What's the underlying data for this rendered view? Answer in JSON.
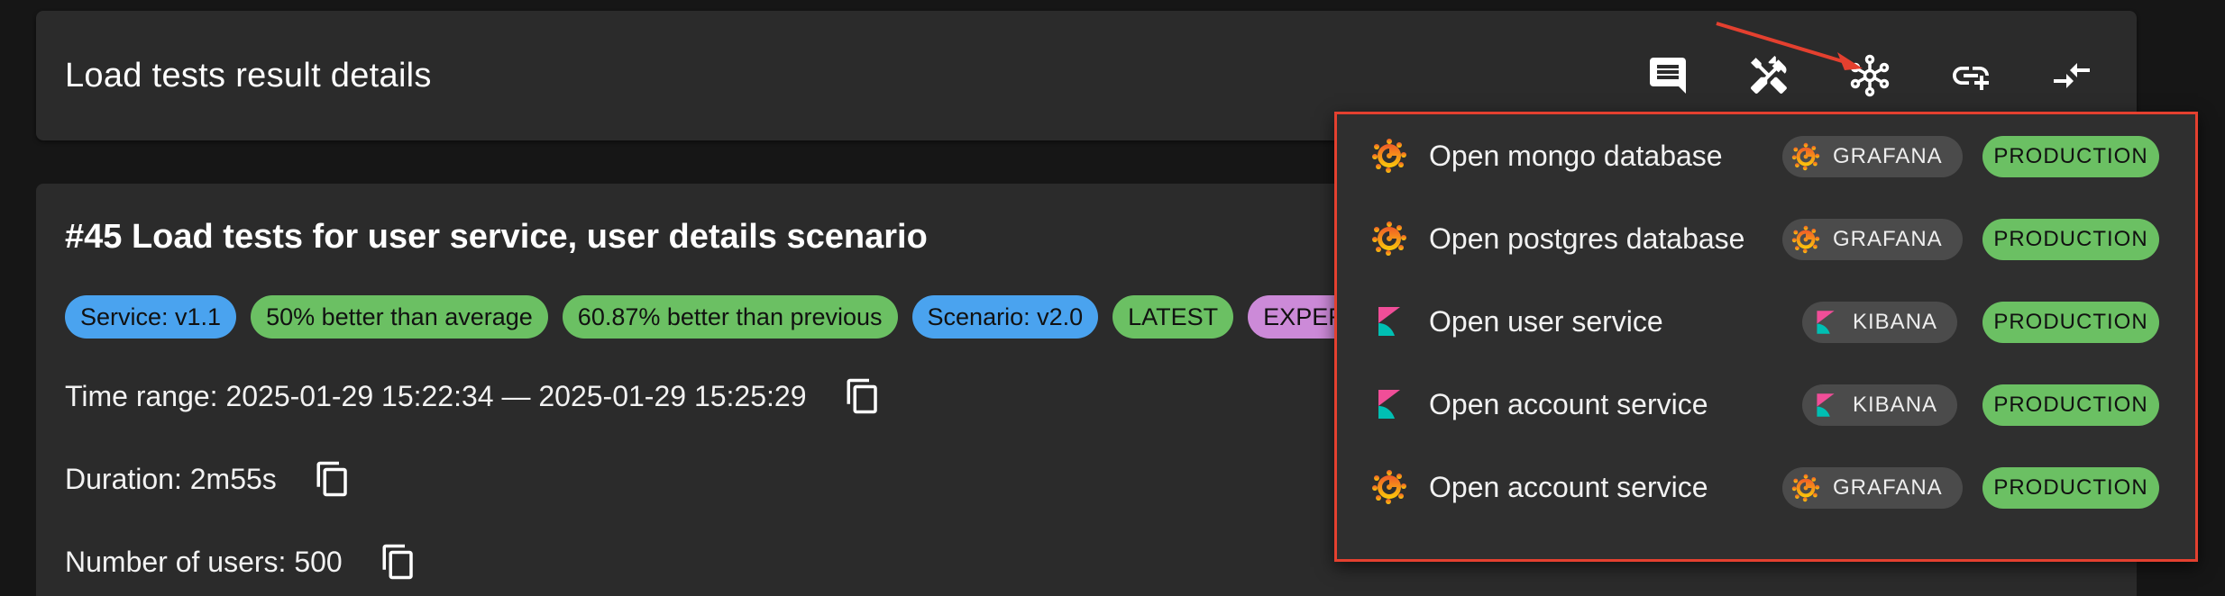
{
  "header": {
    "title": "Load tests result details",
    "toolbar": [
      {
        "name": "comment-icon"
      },
      {
        "name": "tools-icon"
      },
      {
        "name": "network-icon"
      },
      {
        "name": "add-link-icon"
      },
      {
        "name": "compare-icon"
      }
    ]
  },
  "test": {
    "title": "#45 Load tests for user service, user details scenario",
    "chips": [
      {
        "label": "Service: v1.1",
        "color": "#4aa3ef"
      },
      {
        "label": "50% better than average",
        "color": "#6bc063"
      },
      {
        "label": "60.87% better than previous",
        "color": "#6bc063"
      },
      {
        "label": "Scenario: v2.0",
        "color": "#4aa3ef"
      },
      {
        "label": "LATEST",
        "color": "#6bc063"
      },
      {
        "label": "EXPERIME",
        "color": "#cc8ad8"
      }
    ],
    "time_range": "Time range: 2025-01-29 15:22:34 — 2025-01-29 15:25:29",
    "duration": "Duration: 2m55s",
    "users": "Number of users: 500"
  },
  "dropdown": {
    "highlight_color": "#e4402f",
    "items": [
      {
        "label": "Open mongo database",
        "icon": "grafana-icon",
        "tool": "GRAFANA",
        "env": "PRODUCTION"
      },
      {
        "label": "Open postgres database",
        "icon": "grafana-icon",
        "tool": "GRAFANA",
        "env": "PRODUCTION"
      },
      {
        "label": "Open user service",
        "icon": "kibana-icon",
        "tool": "KIBANA",
        "env": "PRODUCTION"
      },
      {
        "label": "Open account service",
        "icon": "kibana-icon",
        "tool": "KIBANA",
        "env": "PRODUCTION"
      },
      {
        "label": "Open account service",
        "icon": "grafana-icon",
        "tool": "GRAFANA",
        "env": "PRODUCTION"
      }
    ]
  }
}
